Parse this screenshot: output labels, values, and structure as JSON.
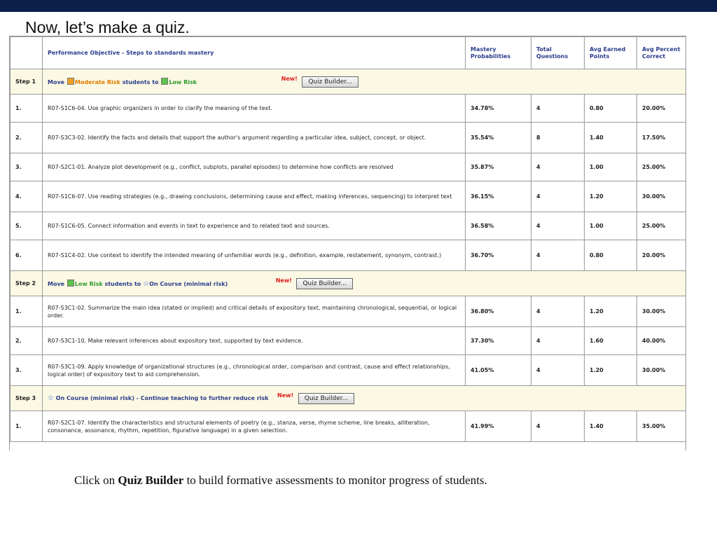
{
  "slide": {
    "title": "Now, let’s make a quiz.",
    "caption_pre": "Click on ",
    "caption_bold": "Quiz Builder",
    "caption_post": " to build formative assessments to monitor progress of students."
  },
  "colors": {
    "top_bar": "#0b1f4b",
    "header_text": "#2b3d8c",
    "step_row_bg": "#fbf8e4",
    "new_badge": "#e01a1a"
  },
  "table": {
    "headers": {
      "objective": "Performance Objective - Steps to standards mastery",
      "mastery": "Mastery Probabilities",
      "total_questions": "Total Questions",
      "avg_points": "Avg Earned Points",
      "avg_percent": "Avg Percent Correct"
    },
    "step1": {
      "label": "Step 1",
      "text_move": "Move",
      "text_from": "Moderate Risk",
      "text_mid": "students to",
      "text_to": "Low Risk",
      "new_badge": "New!",
      "button": "Quiz Builder...",
      "rows": [
        {
          "num": "1.",
          "obj": "R07-S1C6-04. Use graphic organizers in order to clarify the meaning of the text.",
          "mastery": "34.78%",
          "tq": "4",
          "pts": "0.80",
          "pct": "20.00%"
        },
        {
          "num": "2.",
          "obj": "R07-S3C3-02. Identify the facts and details that support the author's argument regarding a particular idea, subject, concept, or object.",
          "mastery": "35.54%",
          "tq": "8",
          "pts": "1.40",
          "pct": "17.50%"
        },
        {
          "num": "3.",
          "obj": "R07-S2C1-01. Analyze plot development (e.g., conflict, subplots, parallel episodes) to determine how conflicts are resolved",
          "mastery": "35.87%",
          "tq": "4",
          "pts": "1.00",
          "pct": "25.00%"
        },
        {
          "num": "4.",
          "obj": "R07-S1C6-07. Use reading strategies (e.g., drawing conclusions, determining cause and effect, making inferences, sequencing) to interpret text",
          "mastery": "36.15%",
          "tq": "4",
          "pts": "1.20",
          "pct": "30.00%"
        },
        {
          "num": "5.",
          "obj": "R07-S1C6-05. Connect information and events in text to experience and to related text and sources.",
          "mastery": "36.58%",
          "tq": "4",
          "pts": "1.00",
          "pct": "25.00%"
        },
        {
          "num": "6.",
          "obj": "R07-S1C4-02. Use context to identify the intended meaning of unfamiliar words (e.g., definition, example, restatement, synonym, contrast.)",
          "mastery": "36.70%",
          "tq": "4",
          "pts": "0.80",
          "pct": "20.00%"
        }
      ]
    },
    "step2": {
      "label": "Step 2",
      "text_move": "Move",
      "text_from": "Low Risk",
      "text_mid": "students to",
      "text_to": "On Course (minimal risk)",
      "new_badge": "New!",
      "button": "Quiz Builder...",
      "rows": [
        {
          "num": "1.",
          "obj": "R07-S3C1-02. Summarize the main idea (stated or implied) and critical details of expository text, maintaining chronological, sequential, or logical order.",
          "mastery": "36.80%",
          "tq": "4",
          "pts": "1.20",
          "pct": "30.00%"
        },
        {
          "num": "2.",
          "obj": "R07-S3C1-10. Make relevant inferences about expository text, supported by text evidence.",
          "mastery": "37.30%",
          "tq": "4",
          "pts": "1.60",
          "pct": "40.00%"
        },
        {
          "num": "3.",
          "obj": "R07-S3C1-09. Apply knowledge of organizational structures (e.g., chronological order, comparison and contrast, cause and effect relationships, logical order) of expository text to aid comprehension.",
          "mastery": "41.05%",
          "tq": "4",
          "pts": "1.20",
          "pct": "30.00%"
        }
      ]
    },
    "step3": {
      "label": "Step 3",
      "text": "On Course (minimal risk) - Continue teaching to further reduce risk",
      "new_badge": "New!",
      "button": "Quiz Builder...",
      "rows": [
        {
          "num": "1.",
          "obj": "R07-S2C1-07. Identify the characteristics and structural elements of poetry (e.g., stanza, verse, rhyme scheme, line breaks, alliteration, consonance, assonance, rhythm, repetition, figurative language) in a given selection.",
          "mastery": "41.99%",
          "tq": "4",
          "pts": "1.40",
          "pct": "35.00%"
        }
      ]
    }
  }
}
